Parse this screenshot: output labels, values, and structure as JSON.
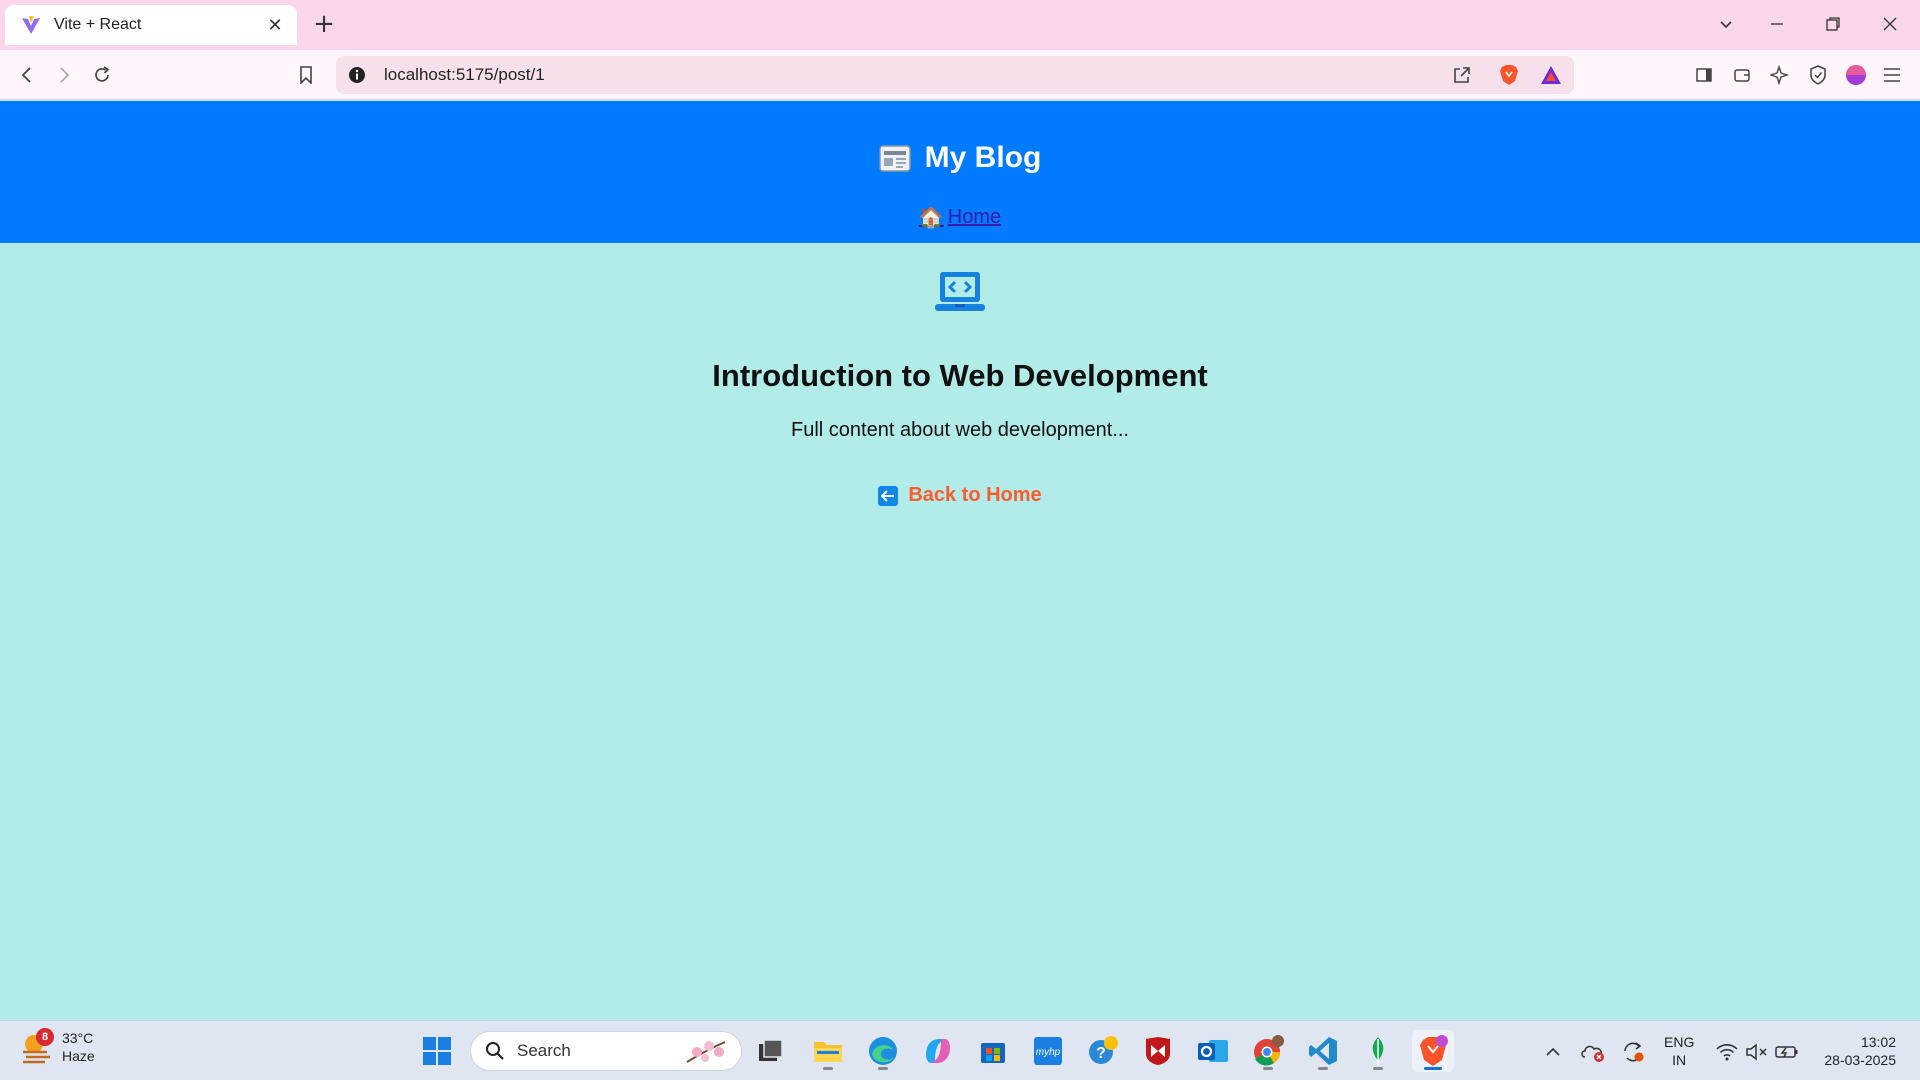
{
  "browser": {
    "tab_title": "Vite + React",
    "tab_close": "✕",
    "new_tab": "+",
    "url": "localhost:5175/post/1"
  },
  "site": {
    "brand_title": "My Blog",
    "nav_home_emoji": "🏠",
    "nav_home": "Home"
  },
  "post": {
    "title": "Introduction to Web Development",
    "content": "Full content about web development...",
    "back_label": "Back to Home"
  },
  "taskbar": {
    "weather_alerts": "8",
    "temperature": "33°C",
    "condition": "Haze",
    "search_label": "Search",
    "lang_primary": "ENG",
    "lang_region": "IN",
    "time": "13:02",
    "date": "28-03-2025"
  },
  "colors": {
    "tabbar": "#f9d6ea",
    "header": "#007bff",
    "page_bg": "#b1ece8",
    "back_link": "#ff5a2c"
  }
}
